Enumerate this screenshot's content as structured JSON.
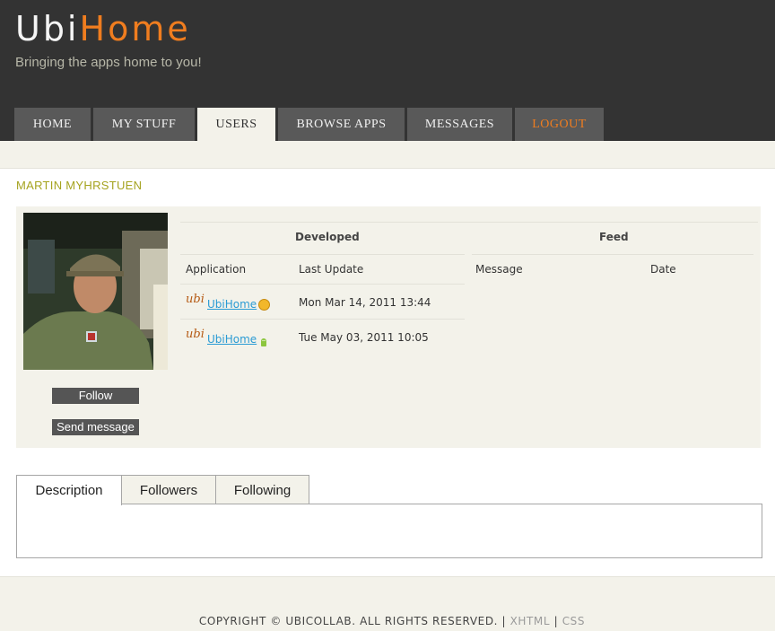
{
  "header": {
    "logo_part1": "Ubi",
    "logo_part2": "Home",
    "tagline": "Bringing the apps home to you!",
    "nav": [
      {
        "label": "HOME"
      },
      {
        "label": "MY STUFF"
      },
      {
        "label": "USERS"
      },
      {
        "label": "BROWSE APPS"
      },
      {
        "label": "MESSAGES"
      },
      {
        "label": "LOGOUT"
      }
    ]
  },
  "profile": {
    "name": "MARTIN MYHRSTUEN",
    "follow_label": "Follow",
    "send_message_label": "Send message",
    "developed": {
      "title": "Developed",
      "columns": [
        "Application",
        "Last Update"
      ],
      "rows": [
        {
          "icon": "ubi-app-icon",
          "app": "UbiHome",
          "status": "status-yellow-icon",
          "updated": "Mon Mar 14, 2011 13:44"
        },
        {
          "icon": "ubi-app-icon",
          "app": "UbiHome",
          "status": "android-icon",
          "updated": "Tue May 03, 2011 10:05"
        }
      ]
    },
    "feed": {
      "title": "Feed",
      "columns": [
        "Message",
        "Date"
      ]
    }
  },
  "tabs": [
    {
      "label": "Description"
    },
    {
      "label": "Followers"
    },
    {
      "label": "Following"
    }
  ],
  "footer": {
    "copyright": "COPYRIGHT © UBICOLLAB. ALL RIGHTS RESERVED. |",
    "xhtml": "XHTML",
    "sep": "|",
    "css": "CSS"
  },
  "colors": {
    "accent": "#f07d1f",
    "header_bg": "#333333",
    "panel_bg": "#f3f2ea",
    "name_color": "#a5a31f",
    "link": "#2a9bd4"
  }
}
